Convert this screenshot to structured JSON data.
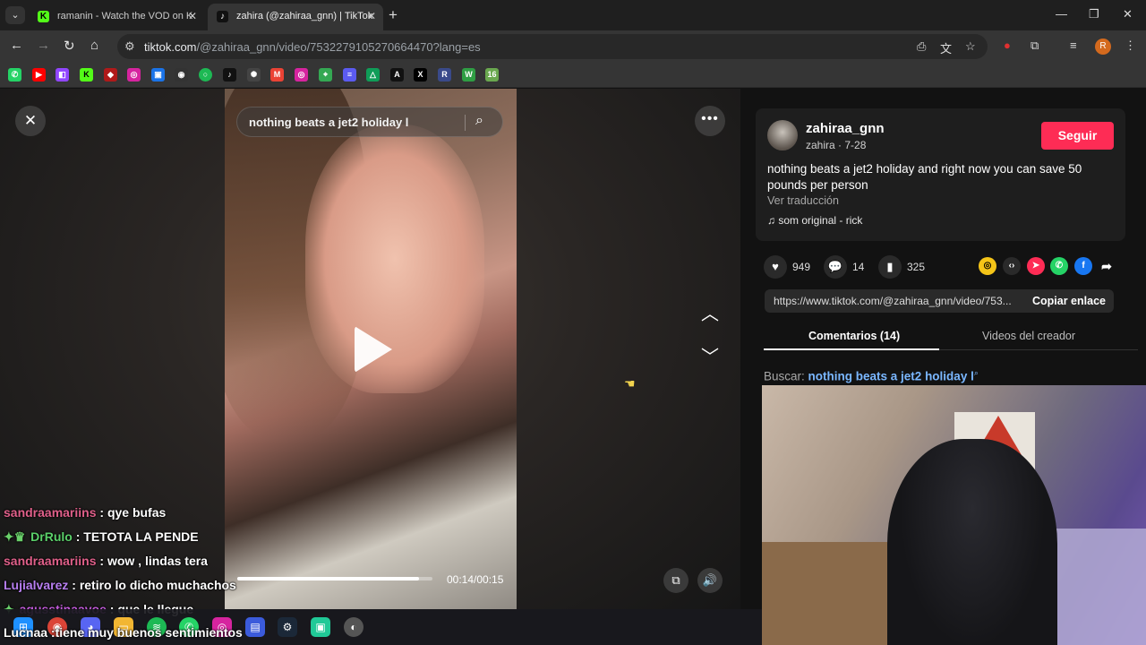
{
  "browser": {
    "tabs": [
      {
        "title": "ramanin - Watch the VOD on K",
        "favicon": "K",
        "active": false
      },
      {
        "title": "zahira (@zahiraa_gnn) | TikTok",
        "favicon": "tiktok-icon",
        "active": true
      }
    ],
    "url_host": "tiktok.com",
    "url_path": "/@zahiraa_gnn/video/7532279105270664470?lang=es",
    "profile_initial": "R",
    "bookmarks": [
      "whatsapp",
      "youtube",
      "twitch",
      "kick",
      "red",
      "instagram",
      "meet",
      "github",
      "green-circle",
      "tiktok",
      "chatgpt",
      "gmail",
      "instagram",
      "maps",
      "list",
      "drive",
      "adobe",
      "x",
      "r",
      "w",
      "16"
    ]
  },
  "video": {
    "search_text": "nothing beats a jet2 holiday l",
    "time": "00:14/00:15",
    "progress": 0.93
  },
  "chat": [
    {
      "user": "sandraamariins",
      "text": " : qye bufas",
      "color": "#e0608a",
      "badges": ""
    },
    {
      "user": "DrRulo",
      "text": " : TETOTA LA PENDE",
      "color": "#5bd06a",
      "badges": "✦♛ "
    },
    {
      "user": "sandraamariins",
      "text": " : wow , lindas tera",
      "color": "#e0608a",
      "badges": ""
    },
    {
      "user": "Lujialvarez",
      "text": " : retiro lo dicho muchachos",
      "color": "#b77ef0",
      "badges": ""
    },
    {
      "user": "agusstinaavoe",
      "text": " : que le llegue",
      "color": "#c05ad8",
      "badges": "✦ "
    },
    {
      "user": "Lucnaa",
      "text": " :tiene muy buenos sentimientos",
      "color": "#ffffff",
      "badges": ""
    }
  ],
  "panel": {
    "username": "zahiraa_gnn",
    "subtitle": "zahira · 7-28",
    "follow_label": "Seguir",
    "description": "nothing beats a jet2 holiday and right now you can save 50 pounds per person",
    "translate_label": "Ver traducción",
    "sound": "som original - rick",
    "likes": "949",
    "comments": "14",
    "saves": "325",
    "link": "https://www.tiktok.com/@zahiraa_gnn/video/753...",
    "copy_label": "Copiar enlace",
    "tab_comments": "Comentarios (14)",
    "tab_creator": "Videos del creador",
    "search_prefix": "Buscar:",
    "search_query": "nothing beats a jet2 holiday l"
  },
  "colors": {
    "accent": "#fe2c55",
    "link": "#7ab7ff"
  }
}
